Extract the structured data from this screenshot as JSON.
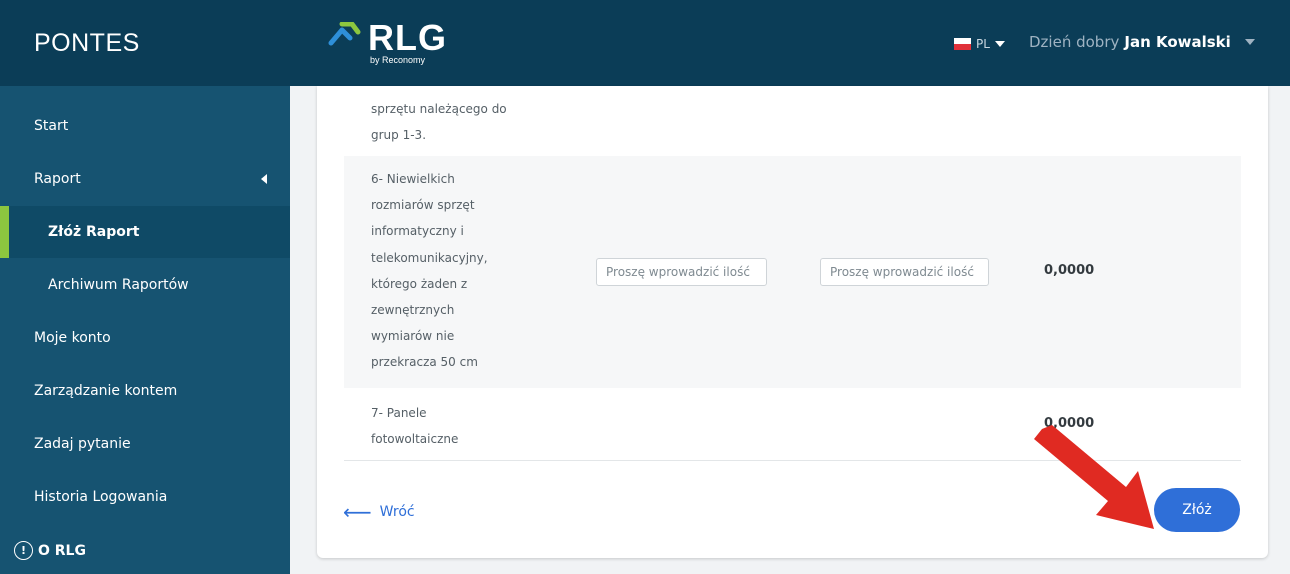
{
  "header": {
    "app_name": "PONTES",
    "logo_text": "RLG",
    "logo_subtitle": "by Reconomy",
    "language": "PL",
    "greeting": "Dzień dobry",
    "user_name": "Jan Kowalski"
  },
  "sidebar": {
    "items": [
      {
        "label": "Start"
      },
      {
        "label": "Raport"
      },
      {
        "label": "Złóż Raport"
      },
      {
        "label": "Archiwum Raportów"
      },
      {
        "label": "Moje konto"
      },
      {
        "label": "Zarządzanie kontem"
      },
      {
        "label": "Zadaj pytanie"
      },
      {
        "label": "Historia Logowania"
      }
    ],
    "about_label": "O RLG"
  },
  "table": {
    "rows": [
      {
        "lines": [
          "sprzętu należącego do",
          "grup 1-3."
        ]
      },
      {
        "lines": [
          "6- Niewielkich",
          "rozmiarów sprzęt",
          "informatyczny i",
          "telekomunikacyjny,",
          "którego żaden z",
          "zewnętrznych",
          "wymiarów nie",
          "przekracza 50 cm"
        ],
        "input1_placeholder": "Proszę wprowadzić ilość",
        "input2_placeholder": "Proszę wprowadzić ilość",
        "value": "0,0000"
      },
      {
        "lines": [
          "7- Panele",
          "fotowoltaiczne"
        ],
        "value": "0,0000"
      }
    ]
  },
  "actions": {
    "back_label": "Wróć",
    "submit_label": "Złóż"
  },
  "colors": {
    "topbar": "#0b3d57",
    "sidebar": "#165371",
    "active_indicator": "#8cc63f",
    "primary": "#2f6fd8",
    "annotation_arrow": "#e02a22"
  }
}
